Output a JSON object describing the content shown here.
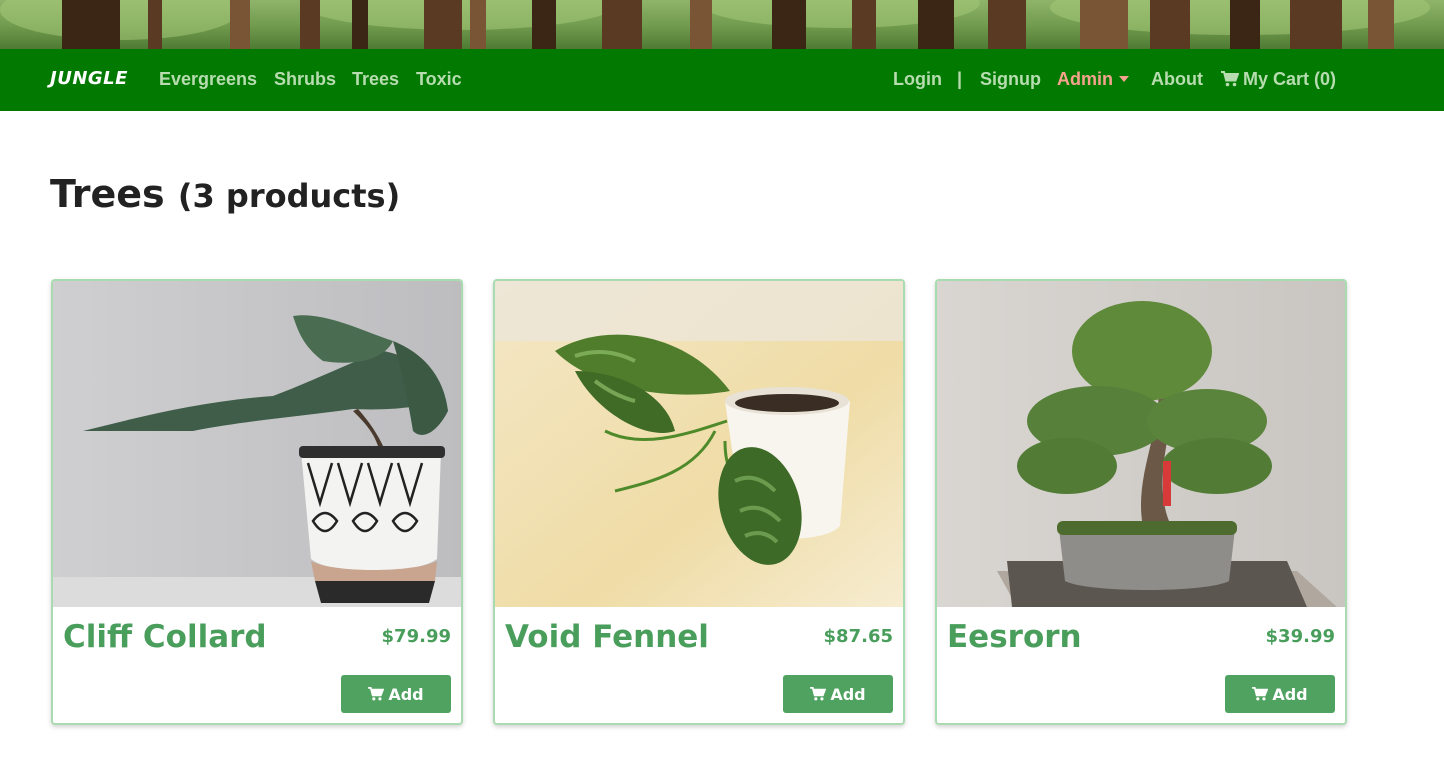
{
  "nav": {
    "brand": "JUNGLE",
    "categories": [
      "Evergreens",
      "Shrubs",
      "Trees",
      "Toxic"
    ],
    "login": "Login",
    "separator": "|",
    "signup": "Signup",
    "admin": "Admin",
    "about": "About",
    "cart": "My Cart (0)",
    "cart_icon": "cart-icon"
  },
  "page": {
    "title": "Trees",
    "count": "(3 products)"
  },
  "products": [
    {
      "name": "Cliff Collard",
      "price": "$79.99",
      "add_label": "Add",
      "image": "juniper-bonsai-in-patterned-pot"
    },
    {
      "name": "Void Fennel",
      "price": "$87.65",
      "add_label": "Add",
      "image": "trailing-pothos-in-white-pot"
    },
    {
      "name": "Eesrorn",
      "price": "$39.99",
      "add_label": "Add",
      "image": "bonsai-tree-in-tray"
    }
  ],
  "colors": {
    "navbar": "#027a02",
    "accent": "#4a9e5c",
    "button": "#4fa25f",
    "admin": "#f5a38d",
    "nav_text": "#b7dcb0"
  }
}
